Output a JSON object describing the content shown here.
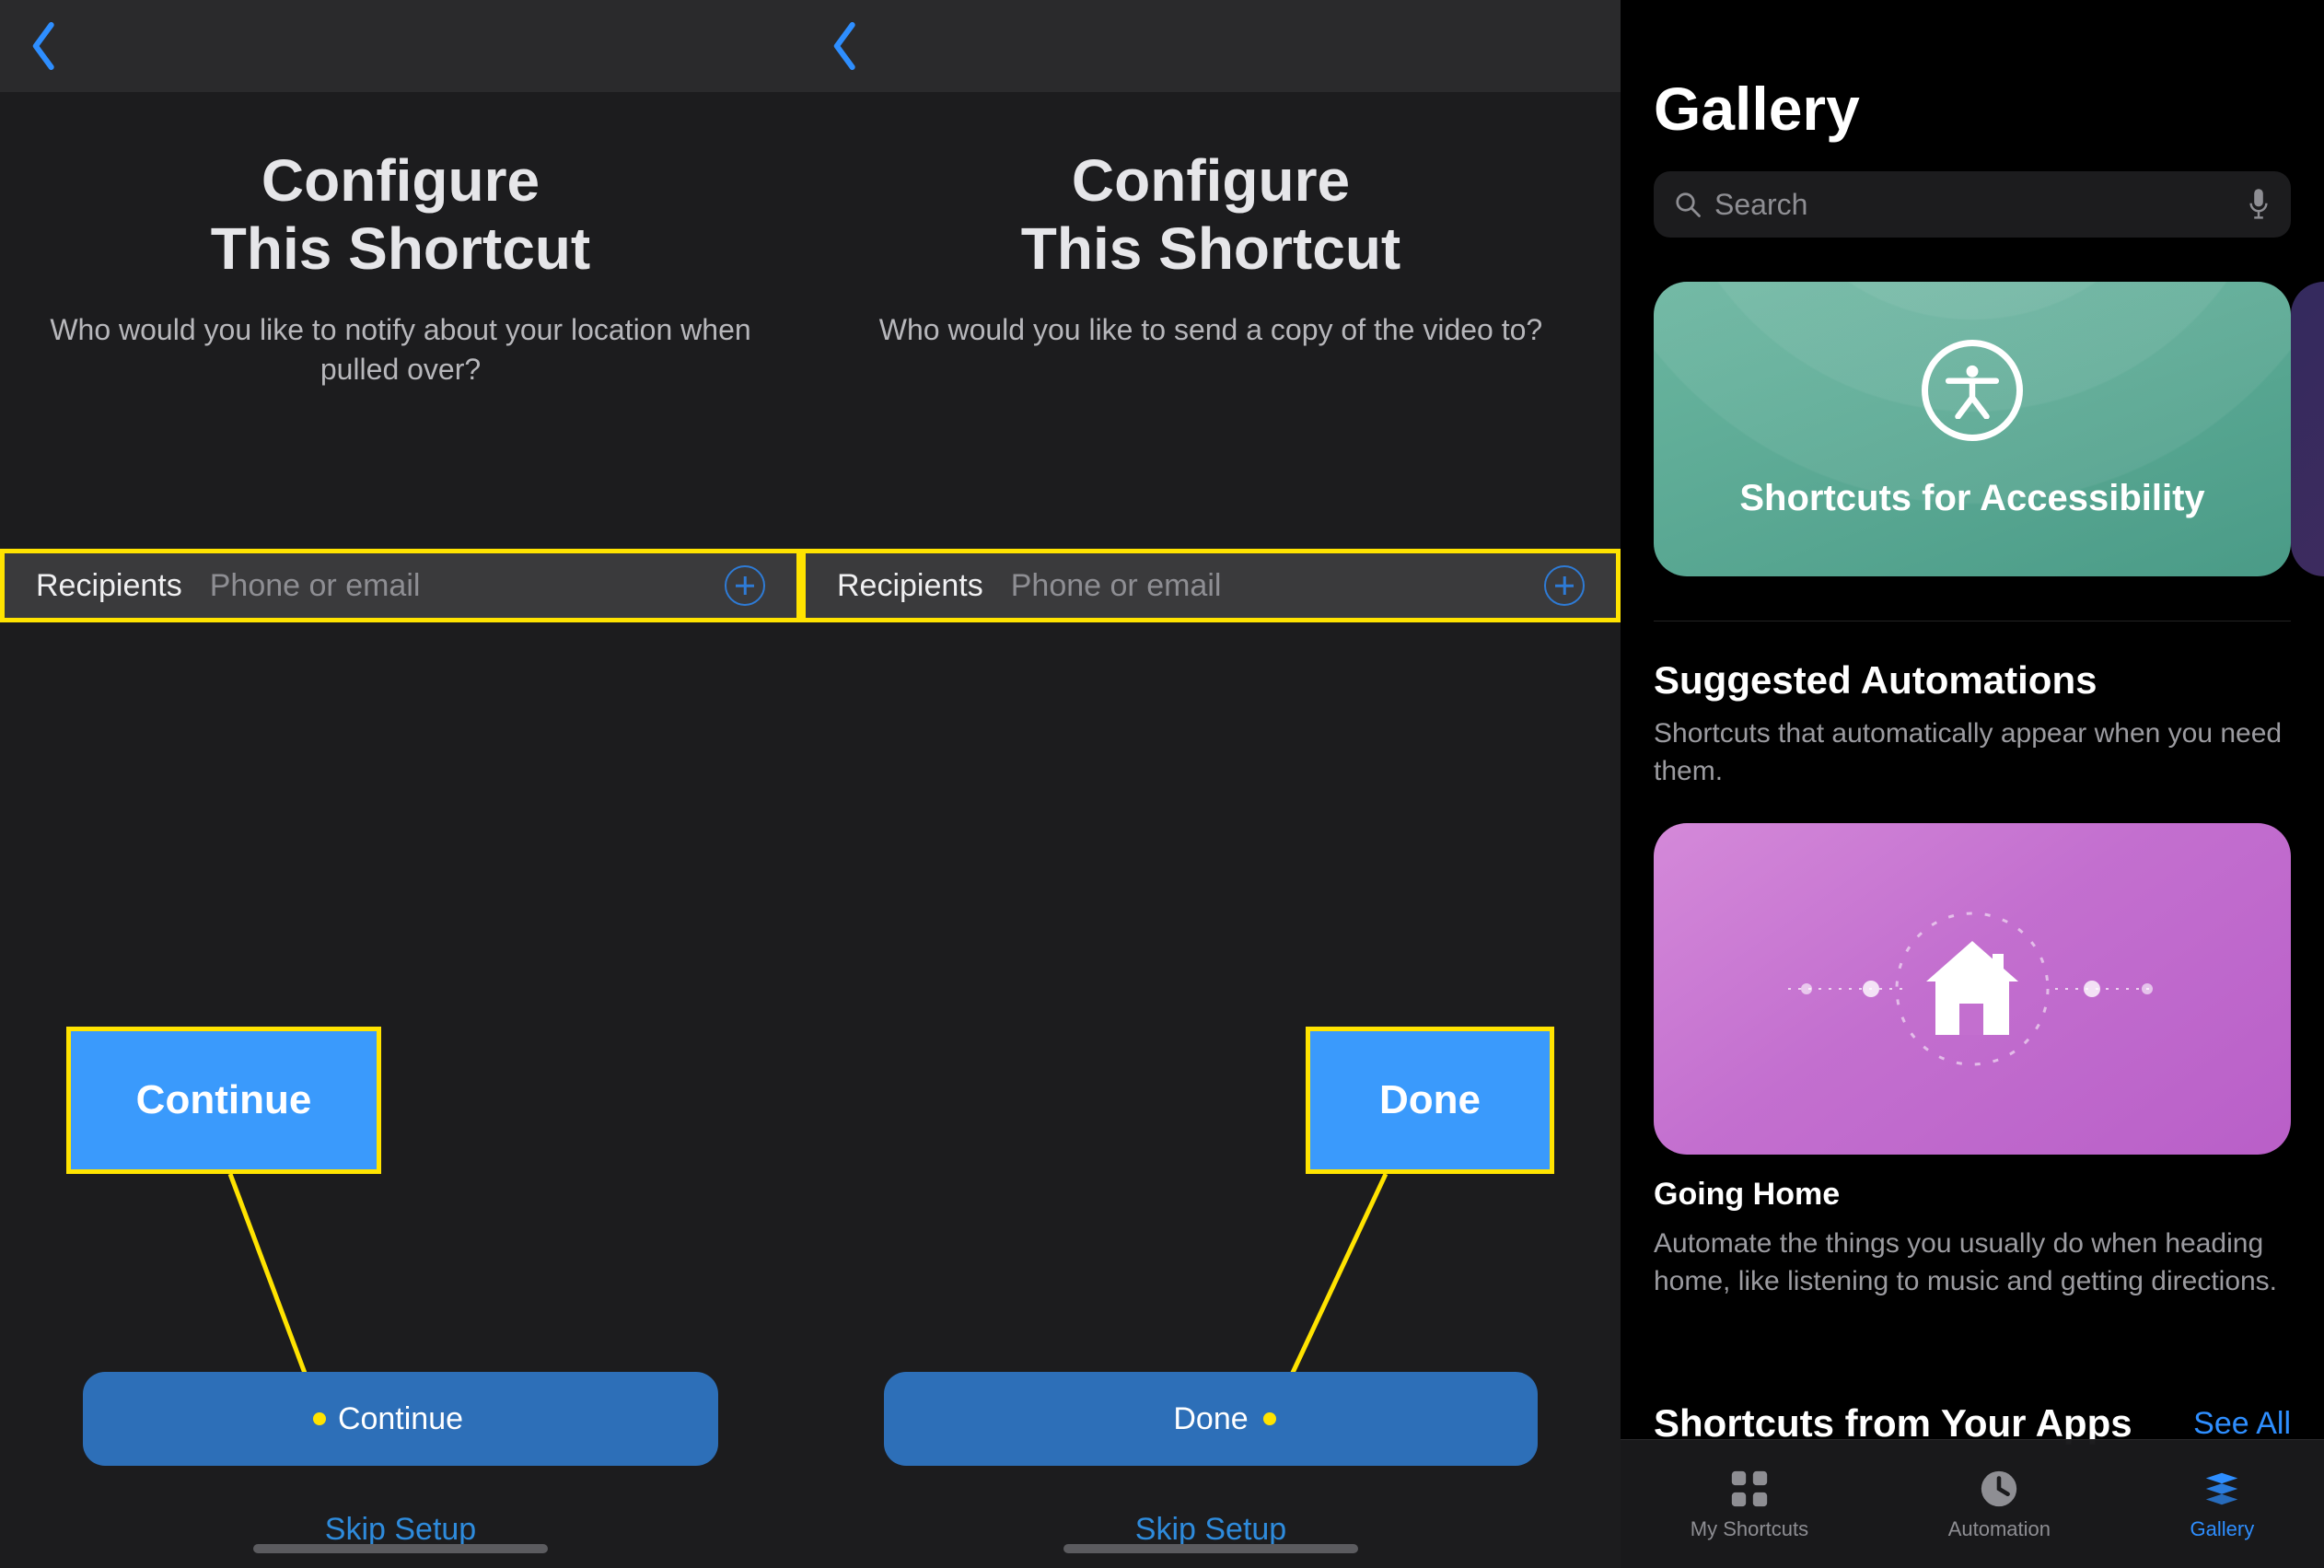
{
  "panel1": {
    "title_line1": "Configure",
    "title_line2": "This Shortcut",
    "subtitle": "Who would you like to notify about your location when pulled over?",
    "recipients_label": "Recipients",
    "recipients_placeholder": "Phone or email",
    "callout_button": "Continue",
    "bottom_button": "Continue",
    "skip_label": "Skip Setup"
  },
  "panel2": {
    "title_line1": "Configure",
    "title_line2": "This Shortcut",
    "subtitle": "Who would you like to send a copy of the video to?",
    "recipients_label": "Recipients",
    "recipients_placeholder": "Phone or email",
    "callout_button": "Done",
    "bottom_button": "Done",
    "skip_label": "Skip Setup"
  },
  "gallery": {
    "title": "Gallery",
    "search_placeholder": "Search",
    "card_access": "Shortcuts for Accessibility",
    "section_suggested_title": "Suggested Automations",
    "section_suggested_sub": "Shortcuts that automatically appear when you need them.",
    "home_card_title": "Going Home",
    "home_card_desc": "Automate the things you usually do when heading home, like listening to music and getting directions.",
    "apps_title": "Shortcuts from Your Apps",
    "see_all": "See All",
    "tabs": {
      "shortcuts": "My Shortcuts",
      "automation": "Automation",
      "gallery": "Gallery"
    }
  }
}
